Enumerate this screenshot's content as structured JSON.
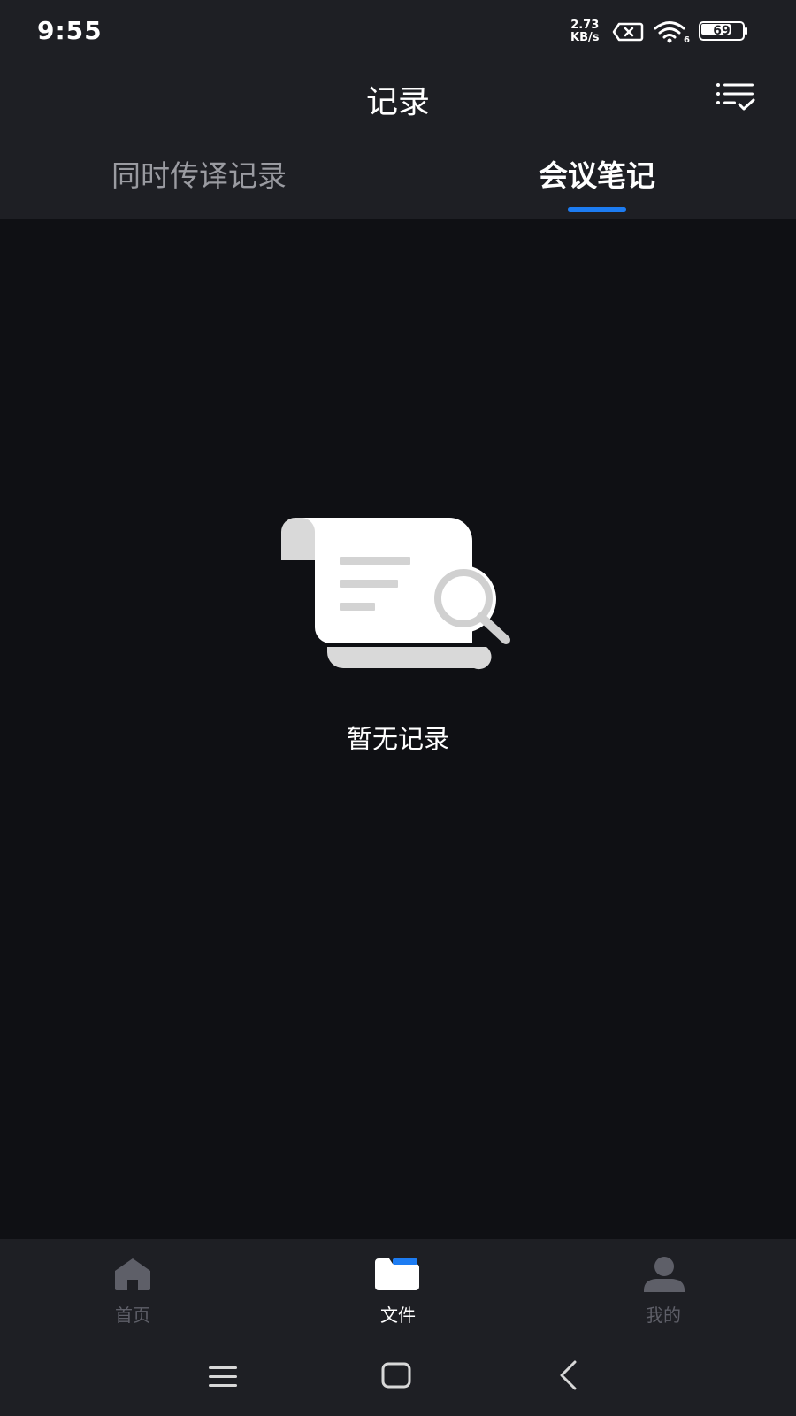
{
  "status_bar": {
    "time": "9:55",
    "net_speed_value": "2.73",
    "net_speed_unit": "KB/s",
    "battery_level": "69"
  },
  "header": {
    "title": "记录",
    "filter_icon": "filter-list-check-icon"
  },
  "tabs": [
    {
      "label": "同时传译记录",
      "active": false
    },
    {
      "label": "会议笔记",
      "active": true
    }
  ],
  "empty_state": {
    "icon": "scroll-search-icon",
    "message": "暂无记录"
  },
  "bottom_nav": [
    {
      "label": "首页",
      "icon": "home-icon",
      "active": false
    },
    {
      "label": "文件",
      "icon": "folder-icon",
      "active": true
    },
    {
      "label": "我的",
      "icon": "user-icon",
      "active": false
    }
  ],
  "system_nav": {
    "menu_icon": "menu-icon",
    "home_icon": "square-home-icon",
    "back_icon": "back-chevron-icon"
  },
  "colors": {
    "accent": "#1d7cf2",
    "background": "#0f1014",
    "bar_background": "#1e1f24",
    "inactive_text": "#9a9ba1"
  }
}
